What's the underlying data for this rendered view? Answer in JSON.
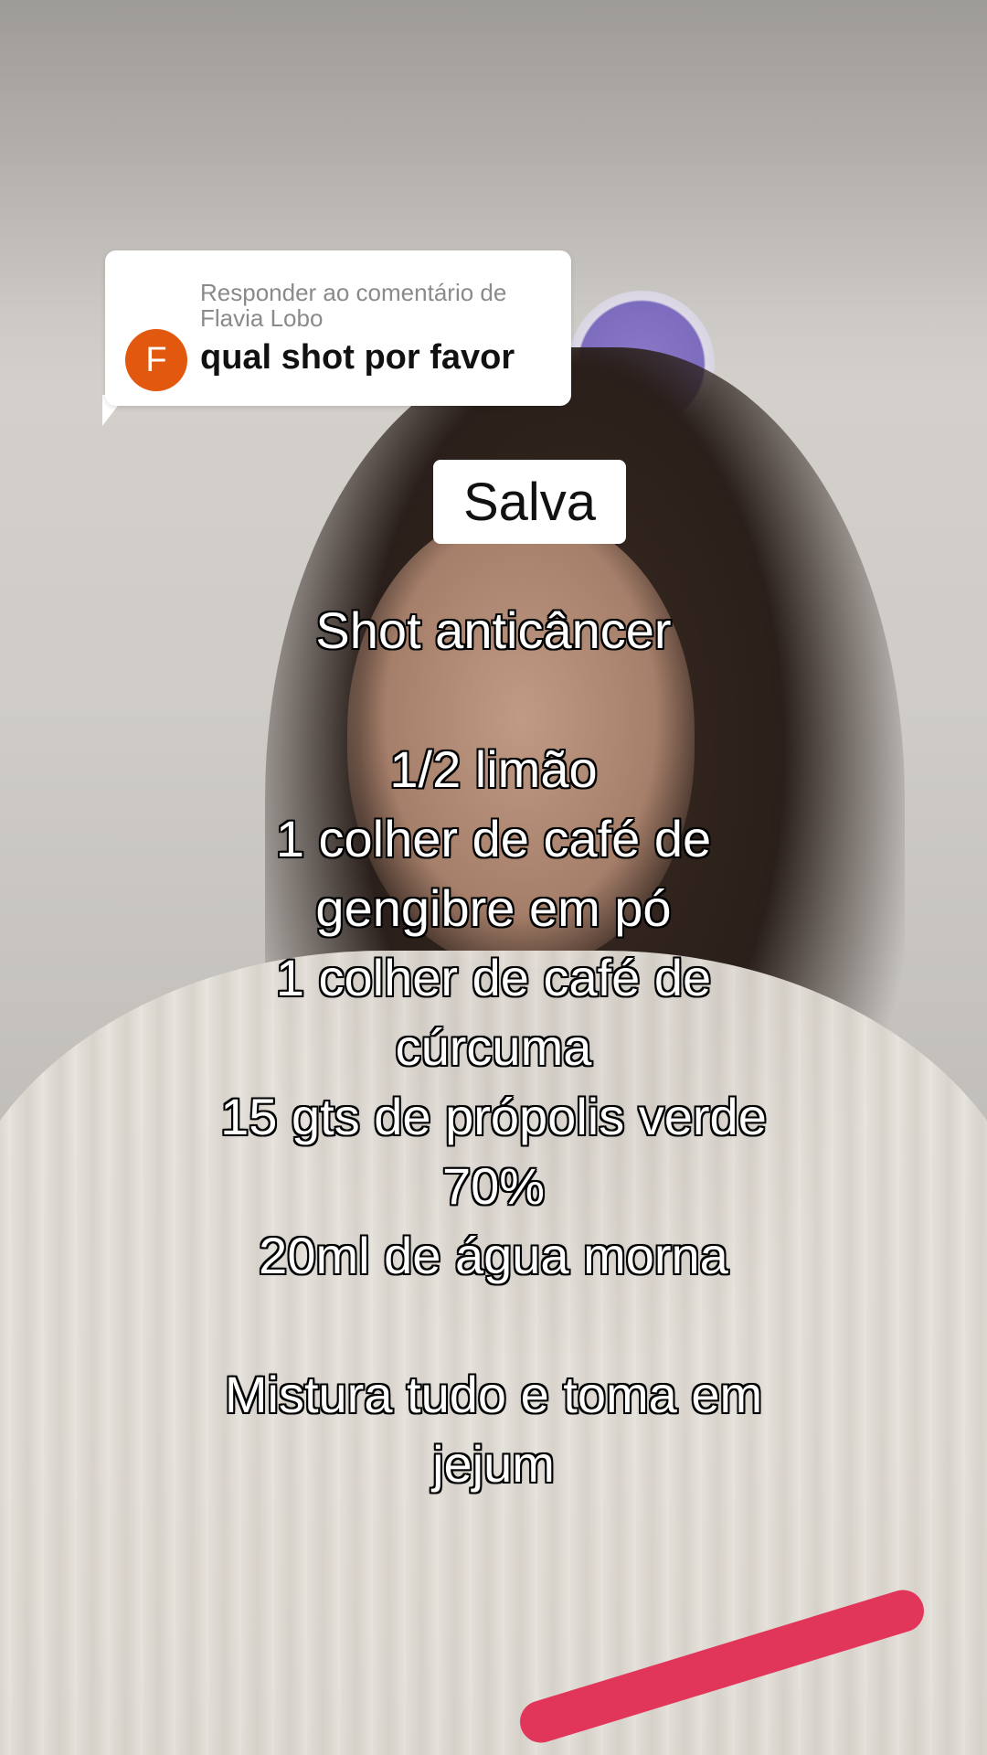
{
  "reply": {
    "meta_line1": "Responder ao comentário de",
    "meta_line2": "Flavia Lobo",
    "avatar_letter": "F",
    "comment": "qual shot por favor",
    "avatar_color": "#e2580f"
  },
  "label": "Salva",
  "caption": {
    "title": "Shot anticâncer",
    "lines": [
      "1/2 limão",
      "1 colher de café de",
      "gengibre em pó",
      "1 colher de café de",
      "cúrcuma",
      "15 gts de própolis verde",
      "70%",
      "20ml de água morna"
    ],
    "closing": [
      "Mistura tudo e toma em",
      "jejum"
    ]
  }
}
